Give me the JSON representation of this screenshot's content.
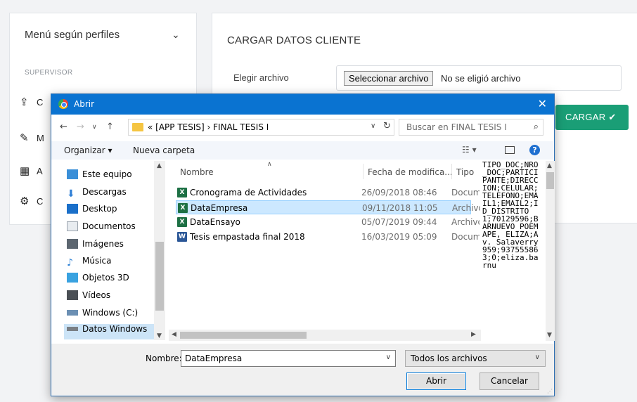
{
  "sidebar": {
    "title": "Menú según perfiles",
    "chevron": "chevron-down-icon",
    "role": "SUPERVISOR",
    "items": [
      {
        "icon": "upload-icon",
        "label": "C"
      },
      {
        "icon": "pencil-icon",
        "label": "M"
      },
      {
        "icon": "calculator-icon",
        "label": "A"
      },
      {
        "icon": "gear-icon",
        "label": "C"
      }
    ]
  },
  "main": {
    "title": "CARGAR DATOS CLIENTE",
    "file_label": "Elegir archivo",
    "file_button": "Seleccionar archivo",
    "file_status": "No se eligió archivo",
    "submit": "CARGAR"
  },
  "dialog": {
    "title": "Abrir",
    "path": "« [APP TESIS] › FINAL TESIS I",
    "search_placeholder": "Buscar en FINAL TESIS I",
    "organize": "Organizar ▾",
    "new_folder": "Nueva carpeta",
    "nav_items": [
      {
        "label": "Este equipo",
        "icon": "computer-icon",
        "color": "#3a8fd8"
      },
      {
        "label": "Descargas",
        "icon": "download-icon",
        "color": "#2f7fd6"
      },
      {
        "label": "Desktop",
        "icon": "desktop-icon",
        "color": "#1a6fc9"
      },
      {
        "label": "Documentos",
        "icon": "documents-icon",
        "color": "#9aa3ad"
      },
      {
        "label": "Imágenes",
        "icon": "images-icon",
        "color": "#5c6670"
      },
      {
        "label": "Música",
        "icon": "music-icon",
        "color": "#2a7fd4"
      },
      {
        "label": "Objetos 3D",
        "icon": "3d-objects-icon",
        "color": "#39a2e0"
      },
      {
        "label": "Vídeos",
        "icon": "videos-icon",
        "color": "#4a4f55"
      },
      {
        "label": "Windows (C:)",
        "icon": "drive-icon",
        "color": "#6b8fb3"
      },
      {
        "label": "Datos Windows",
        "icon": "drive-icon",
        "color": "#7a7f85"
      }
    ],
    "columns": [
      "Nombre",
      "Fecha de modifica...",
      "Tipo"
    ],
    "files": [
      {
        "name": "Cronograma de Actividades",
        "date": "26/09/2018 08:46",
        "type": "Docum",
        "kind": "x",
        "selected": false
      },
      {
        "name": "DataEmpresa",
        "date": "09/11/2018 11:05",
        "type": "Archivo",
        "kind": "x",
        "selected": true
      },
      {
        "name": "DataEnsayo",
        "date": "05/07/2019 09:44",
        "type": "Archivo",
        "kind": "x",
        "selected": false
      },
      {
        "name": "Tesis empastada final 2018",
        "date": "16/03/2019 05:09",
        "type": "Docum",
        "kind": "w",
        "selected": false
      }
    ],
    "preview": "TIPO_DOC;NRO_DOC;PARTICIPANTE;DIRECCION;CELULAR;TELEFONO;EMAIL1;EMAIL2;ID_DISTRITO\n1;70129596;BARNUEVO POEMAPE, ELIZA;Av. Salaverry 959;937555863;0;eliza.barnu",
    "name_label": "Nombre:",
    "name_value": "DataEmpresa",
    "filter_value": "Todos los archivos",
    "open_button": "Abrir",
    "cancel_button": "Cancelar"
  }
}
